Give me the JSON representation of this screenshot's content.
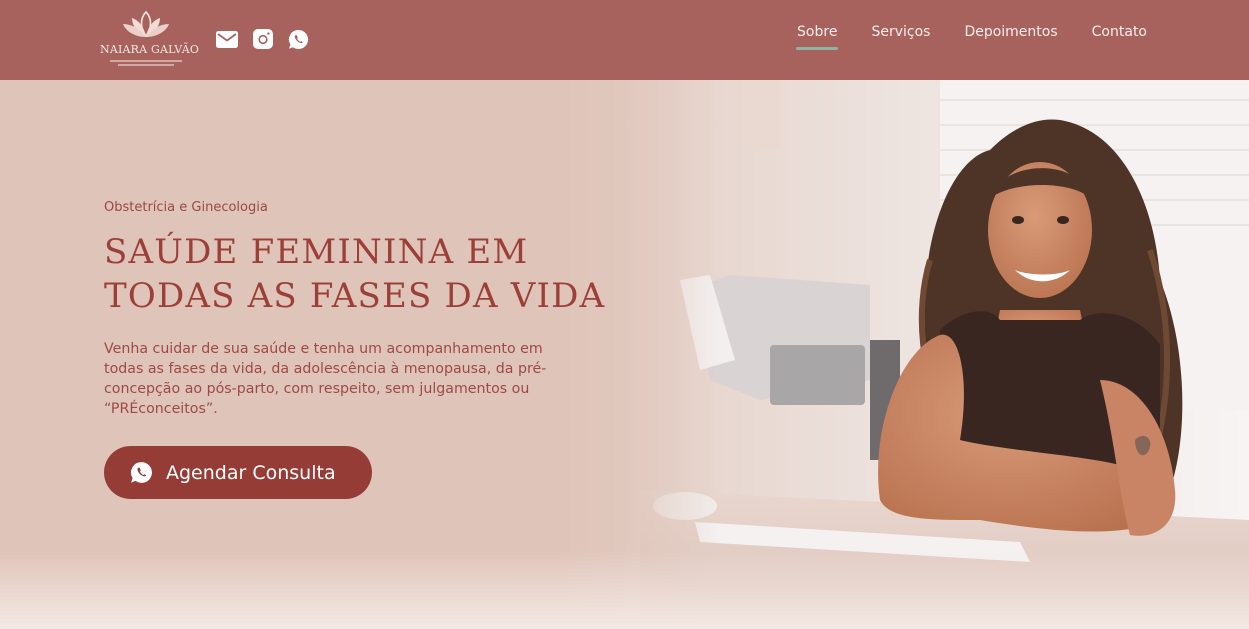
{
  "header": {
    "logo": {
      "name": "NAIARA GALVÃO",
      "icon": "lotus-icon"
    },
    "social": [
      {
        "name": "email",
        "icon": "mail-icon"
      },
      {
        "name": "instagram",
        "icon": "instagram-icon"
      },
      {
        "name": "whatsapp",
        "icon": "whatsapp-icon"
      }
    ],
    "nav": {
      "items": [
        {
          "label": "Sobre",
          "active": true
        },
        {
          "label": "Serviços",
          "active": false
        },
        {
          "label": "Depoimentos",
          "active": false
        },
        {
          "label": "Contato",
          "active": false
        }
      ]
    }
  },
  "hero": {
    "eyebrow": "Obstetrícia e Ginecologia",
    "headline_line1": "SAÚDE FEMININA EM",
    "headline_line2": "TODAS AS FASES DA VIDA",
    "lead": "Venha cuidar de sua saúde e tenha um acompanhamento em todas as fases da vida, da adolescência à menopausa, da pré-concepção ao pós-parto, com respeito, sem julgamentos ou “PRÉconceitos”.",
    "cta_label": "Agendar Consulta",
    "cta_icon": "whatsapp-icon",
    "photo": "doctor-portrait-photo"
  },
  "colors": {
    "header_bg": "#a8625d",
    "hero_bg": "#dfc4b9",
    "accent": "#963c36",
    "nav_underline": "#8fb3a3"
  }
}
